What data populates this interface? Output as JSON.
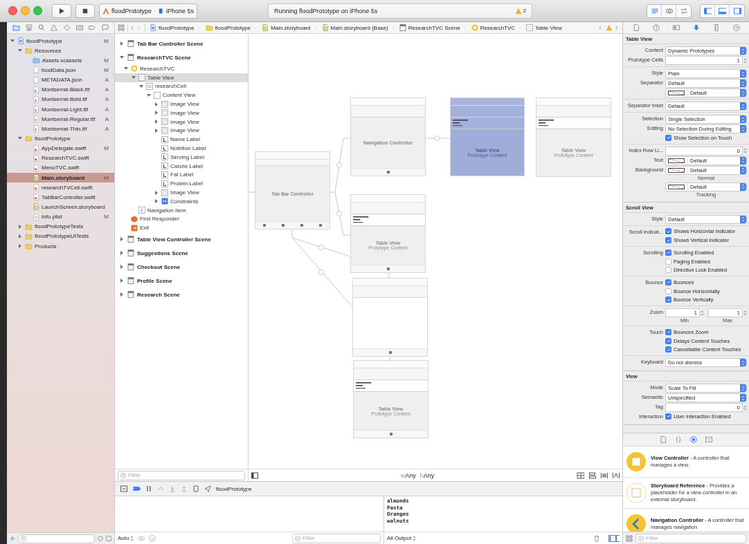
{
  "toolbar": {
    "scheme": "floodPrototype",
    "device": "iPhone 5s",
    "status": "Running floodPrototype on iPhone 5s",
    "warnings": "2"
  },
  "navigator": {
    "tabs": [
      {
        "kind": "folder",
        "selected": true
      },
      {
        "kind": "hierarchy",
        "selected": false
      },
      {
        "kind": "search",
        "selected": false
      },
      {
        "kind": "warning",
        "selected": false
      },
      {
        "kind": "diamond",
        "selected": false
      },
      {
        "kind": "list",
        "selected": false
      },
      {
        "kind": "tag",
        "selected": false
      },
      {
        "kind": "message",
        "selected": false
      }
    ],
    "items": [
      {
        "name": "floodPrototype",
        "kind": "project",
        "badge": "M",
        "selected": false,
        "expanded": true,
        "children": [
          {
            "name": "Resources",
            "kind": "folder",
            "selected": false,
            "expanded": true,
            "children": [
              {
                "name": "Assets.xcassets",
                "kind": "assets",
                "badge": "M",
                "selected": false
              },
              {
                "name": "foodData.json",
                "kind": "file",
                "badge": "M",
                "selected": false
              },
              {
                "name": "METADATA.json",
                "kind": "file",
                "badge": "A",
                "selected": false
              },
              {
                "name": "Montserrat-Black.ttf",
                "kind": "font",
                "badge": "A",
                "selected": false
              },
              {
                "name": "Montserrat-Bold.ttf",
                "kind": "font",
                "badge": "A",
                "selected": false
              },
              {
                "name": "Montserrat-Light.ttf",
                "kind": "font",
                "badge": "A",
                "selected": false
              },
              {
                "name": "Montserrat-Regular.ttf",
                "kind": "font",
                "badge": "A",
                "selected": false
              },
              {
                "name": "Montserrat-Thin.ttf",
                "kind": "font",
                "badge": "A",
                "selected": false
              }
            ]
          },
          {
            "name": "floodPrototype",
            "kind": "folder",
            "selected": false,
            "expanded": true,
            "children": [
              {
                "name": "AppDelegate.swift",
                "kind": "swift",
                "badge": "M",
                "selected": false
              },
              {
                "name": "ResearchTVC.swift",
                "kind": "swift",
                "selected": false
              },
              {
                "name": "MenuTVC.swift",
                "kind": "swift",
                "selected": false
              },
              {
                "name": "Main.storyboard",
                "kind": "storyboard",
                "badge": "M",
                "selected": true
              },
              {
                "name": "researchTVCell.swift",
                "kind": "swift",
                "selected": false
              },
              {
                "name": "TabBarController.swift",
                "kind": "swift",
                "selected": false
              },
              {
                "name": "LaunchScreen.storyboard",
                "kind": "storyboard",
                "selected": false
              },
              {
                "name": "Info.plist",
                "kind": "plist",
                "badge": "M",
                "selected": false
              }
            ]
          },
          {
            "name": "floodPrototypeTests",
            "kind": "folder",
            "selected": false,
            "expanded": false
          },
          {
            "name": "floodPrototypeUITests",
            "kind": "folder",
            "selected": false,
            "expanded": false
          },
          {
            "name": "Products",
            "kind": "folder",
            "selected": false,
            "expanded": false
          }
        ]
      }
    ]
  },
  "jump_bar": [
    {
      "label": "floodPrototype",
      "kind": "project"
    },
    {
      "label": "floodPrototype",
      "kind": "folder"
    },
    {
      "label": "Main.storyboard",
      "kind": "storyboard"
    },
    {
      "label": "Main.storyboard (Base)",
      "kind": "storyboard"
    },
    {
      "label": "ResearchTVC Scene",
      "kind": "scene"
    },
    {
      "label": "ResearchTVC",
      "kind": "controller"
    },
    {
      "label": "Table View",
      "kind": "table"
    }
  ],
  "outline": {
    "filter_placeholder": "Filter",
    "scenes": [
      {
        "name": "Tab Bar Controller Scene",
        "expanded": false,
        "selected": false
      },
      {
        "name": "ResearchTVC Scene",
        "expanded": true,
        "selected": false,
        "children": [
          {
            "name": "ResearchTVC",
            "kind": "controller",
            "expanded": true,
            "selected": false,
            "children": [
              {
                "name": "Table View",
                "kind": "table",
                "expanded": true,
                "selected": true,
                "children": [
                  {
                    "name": "researchCell",
                    "kind": "cell",
                    "expanded": true,
                    "selected": false,
                    "children": [
                      {
                        "name": "Content View",
                        "kind": "view",
                        "expanded": true,
                        "selected": false,
                        "children": [
                          {
                            "name": "Image View",
                            "kind": "image",
                            "expanded": false,
                            "selected": false
                          },
                          {
                            "name": "Image View",
                            "kind": "image",
                            "expanded": false,
                            "selected": false
                          },
                          {
                            "name": "Image View",
                            "kind": "image",
                            "expanded": false,
                            "selected": false
                          },
                          {
                            "name": "Image View",
                            "kind": "image",
                            "expanded": false,
                            "selected": false
                          },
                          {
                            "name": "Name Label",
                            "kind": "label",
                            "selected": false
                          },
                          {
                            "name": "Nutrition Label",
                            "kind": "label",
                            "selected": false
                          },
                          {
                            "name": "Serving Label",
                            "kind": "label",
                            "selected": false
                          },
                          {
                            "name": "Calorie Label",
                            "kind": "label",
                            "selected": false
                          },
                          {
                            "name": "Fat Label",
                            "kind": "label",
                            "selected": false
                          },
                          {
                            "name": "Protein Label",
                            "kind": "label",
                            "selected": false
                          },
                          {
                            "name": "Image View",
                            "kind": "image",
                            "expanded": false,
                            "selected": false
                          },
                          {
                            "name": "Constraints",
                            "kind": "constraints",
                            "expanded": false,
                            "selected": false
                          }
                        ]
                      }
                    ]
                  }
                ]
              },
              {
                "name": "Navigation Item",
                "kind": "navitem",
                "selected": false
              }
            ]
          },
          {
            "name": "First Responder",
            "kind": "responder",
            "selected": false
          },
          {
            "name": "Exit",
            "kind": "exit",
            "selected": false
          }
        ]
      },
      {
        "name": "Table View Controller Scene",
        "expanded": false,
        "selected": false
      },
      {
        "name": "Suggestions Scene",
        "expanded": false,
        "selected": false
      },
      {
        "name": "Checkout Scene",
        "expanded": false,
        "selected": false
      },
      {
        "name": "Profile Scene",
        "expanded": false,
        "selected": false
      },
      {
        "name": "Research Scene",
        "expanded": false,
        "selected": false
      }
    ]
  },
  "canvas": {
    "scenes": [
      {
        "kind": "tab_bar_controller",
        "label": "Tab Bar Controller",
        "selected": false,
        "tab_bar": true
      },
      {
        "kind": "navigation_controller",
        "label": "Navigation Controller",
        "selected": false,
        "tab_bar": true
      },
      {
        "kind": "table_view_controller",
        "label": "Table View",
        "sublabel": "Prototype Content",
        "selected": true,
        "tab_bar": false
      },
      {
        "kind": "table_view_controller",
        "label": "Table View",
        "sublabel": "Prototype Content",
        "selected": false,
        "tab_bar": false
      },
      {
        "kind": "table_view_controller",
        "label": "Table View",
        "sublabel": "Prototype Content",
        "selected": false,
        "tab_bar": true
      },
      {
        "kind": "view_controller",
        "selected": false,
        "tab_bar": true
      },
      {
        "kind": "table_view_controller",
        "label": "Table View",
        "sublabel": "Prototype Content",
        "selected": false,
        "tab_bar": true
      }
    ],
    "size_class": [
      {
        "prefix": "w",
        "value": "Any"
      },
      {
        "prefix": "h",
        "value": "Any"
      }
    ]
  },
  "debug": {
    "target": "floodPrototype",
    "scope": "Auto",
    "filter_placeholder": "Filter",
    "console": [
      "almonds",
      "Pasta",
      "Oranges",
      "walnuts"
    ],
    "output": "All Output"
  },
  "inspector": {
    "tabs": [
      {
        "kind": "file",
        "selected": false
      },
      {
        "kind": "help",
        "selected": false
      },
      {
        "kind": "identity",
        "selected": false
      },
      {
        "kind": "attributes",
        "selected": true
      },
      {
        "kind": "ruler",
        "selected": false
      },
      {
        "kind": "connections",
        "selected": false
      }
    ],
    "sections": [
      {
        "title": "Table View",
        "groups": [
          [
            {
              "kind": "popup",
              "label": "Content",
              "value": "Dynamic Prototypes"
            },
            {
              "kind": "stepper",
              "label": "Prototype Cells",
              "value": "1"
            }
          ],
          [
            {
              "kind": "popup",
              "label": "Style",
              "value": "Plain"
            },
            {
              "kind": "popup",
              "label": "Separator",
              "value": "Default"
            },
            {
              "kind": "color",
              "value": "Default"
            }
          ],
          [
            {
              "kind": "popup",
              "label": "Separator Inset",
              "value": "Default"
            }
          ],
          [
            {
              "kind": "popup",
              "label": "Selection",
              "value": "Single Selection"
            },
            {
              "kind": "popup",
              "label": "Editing",
              "value": "No Selection During Editing"
            },
            {
              "kind": "checkbox",
              "text": "Show Selection on Touch",
              "checked": true
            }
          ],
          [
            {
              "kind": "stepper",
              "label": "Index Row Li...",
              "value": "0"
            },
            {
              "kind": "color",
              "label": "Text",
              "value": "Default"
            },
            {
              "kind": "color",
              "label": "Background",
              "value": "Default",
              "caption": "Normal"
            },
            {
              "kind": "color",
              "value": "Default",
              "caption": "Tracking"
            }
          ]
        ]
      },
      {
        "title": "Scroll View",
        "groups": [
          [
            {
              "kind": "popup",
              "label": "Style",
              "value": "Default"
            }
          ],
          [
            {
              "kind": "checkbox",
              "label": "Scroll Indicat...",
              "text": "Shows Horizontal Indicator",
              "checked": true
            },
            {
              "kind": "checkbox",
              "text": "Shows Vertical Indicator",
              "checked": true
            }
          ],
          [
            {
              "kind": "checkbox",
              "label": "Scrolling",
              "text": "Scrolling Enabled",
              "checked": true
            },
            {
              "kind": "checkbox",
              "text": "Paging Enabled",
              "checked": false
            },
            {
              "kind": "checkbox",
              "text": "Direction Lock Enabled",
              "checked": false
            }
          ],
          [
            {
              "kind": "checkbox",
              "label": "Bounce",
              "text": "Bounces",
              "checked": true
            },
            {
              "kind": "checkbox",
              "text": "Bounce Horizontally",
              "checked": false
            },
            {
              "kind": "checkbox",
              "text": "Bounce Vertically",
              "checked": true
            }
          ],
          [
            {
              "kind": "zoom",
              "label": "Zoom",
              "fields": [
                {
                  "value": "1",
                  "caption": "Min"
                },
                {
                  "value": "1",
                  "caption": "Max"
                }
              ]
            }
          ],
          [
            {
              "kind": "checkbox",
              "label": "Touch",
              "text": "Bounces Zoom",
              "checked": true
            },
            {
              "kind": "checkbox",
              "text": "Delays Content Touches",
              "checked": true
            },
            {
              "kind": "checkbox",
              "text": "Cancellable Content Touches",
              "checked": true
            }
          ],
          [
            {
              "kind": "popup",
              "label": "Keyboard",
              "value": "Do not dismiss"
            }
          ]
        ]
      },
      {
        "title": "View",
        "groups": [
          [
            {
              "kind": "popup",
              "label": "Mode",
              "value": "Scale To Fill"
            },
            {
              "kind": "popup",
              "label": "Semantic",
              "value": "Unspecified"
            },
            {
              "kind": "stepper",
              "label": "Tag",
              "value": "0"
            },
            {
              "kind": "checkbox",
              "label": "Interaction",
              "text": "User Interaction Enabled",
              "checked": true
            }
          ]
        ]
      }
    ]
  },
  "library": {
    "tabs": [
      {
        "kind": "file",
        "selected": false
      },
      {
        "kind": "braces",
        "selected": false
      },
      {
        "kind": "object",
        "selected": true
      },
      {
        "kind": "media",
        "selected": false
      }
    ],
    "items": [
      {
        "kind": "solid",
        "text": "**View Controller** - A controller that manages a view."
      },
      {
        "kind": "dashed",
        "text": "**Storyboard Reference** - Provides a placeholder for a view controller in an external storyboard."
      },
      {
        "kind": "navigation",
        "text": "**Navigation Controller** - A controller that manages navigation"
      }
    ],
    "filter_placeholder": "Filter"
  }
}
